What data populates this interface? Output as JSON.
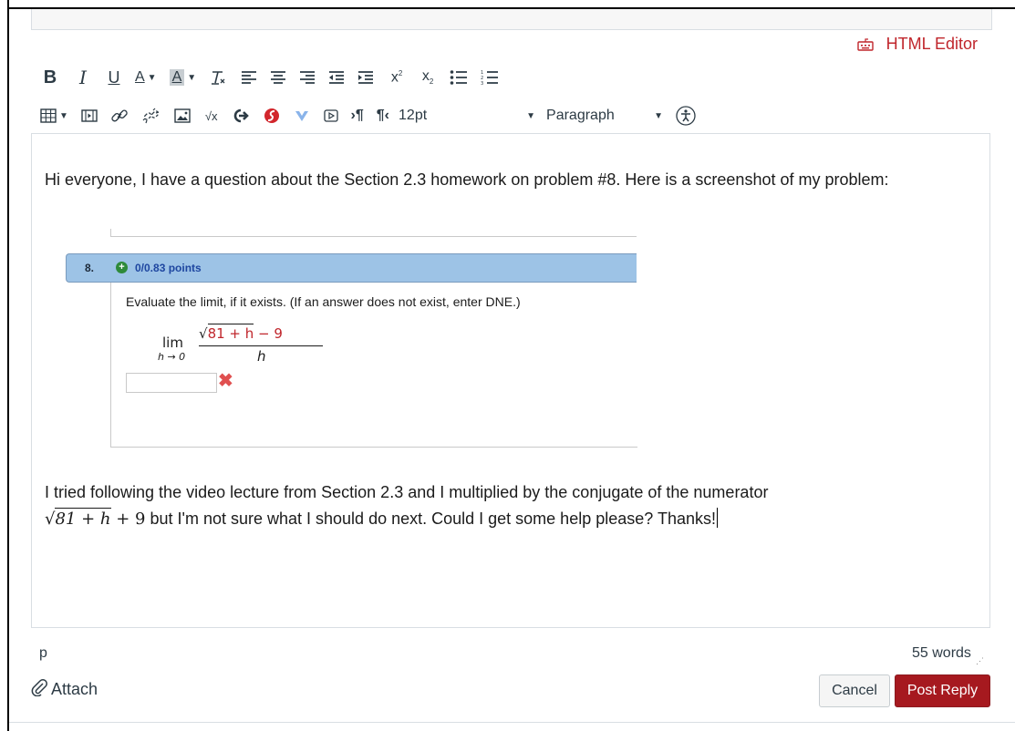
{
  "header": {
    "html_editor_label": "HTML Editor"
  },
  "toolbar": {
    "row1": [
      {
        "name": "bold-button",
        "icon": "bold-icon",
        "glyph": "B"
      },
      {
        "name": "italic-button",
        "icon": "italic-icon",
        "glyph": "I"
      },
      {
        "name": "underline-button",
        "icon": "underline-icon",
        "glyph": "U"
      },
      {
        "name": "text-color-button",
        "icon": "text-color-icon",
        "glyph": "A"
      },
      {
        "name": "background-color-button",
        "icon": "background-color-icon",
        "glyph": "A"
      },
      {
        "name": "clear-formatting-button",
        "icon": "clear-formatting-icon",
        "glyph": "Tx"
      },
      {
        "name": "align-left-button",
        "icon": "align-left-icon"
      },
      {
        "name": "align-center-button",
        "icon": "align-center-icon"
      },
      {
        "name": "align-right-button",
        "icon": "align-right-icon"
      },
      {
        "name": "outdent-button",
        "icon": "outdent-icon"
      },
      {
        "name": "indent-button",
        "icon": "indent-icon"
      },
      {
        "name": "superscript-button",
        "icon": "superscript-icon"
      },
      {
        "name": "subscript-button",
        "icon": "subscript-icon"
      },
      {
        "name": "bulleted-list-button",
        "icon": "bulleted-list-icon"
      },
      {
        "name": "numbered-list-button",
        "icon": "numbered-list-icon"
      }
    ],
    "font_size": "12pt",
    "block_format": "Paragraph"
  },
  "editor": {
    "paragraph1": "Hi everyone, I have a question about the Section 2.3 homework on problem #8. Here is a screenshot of my problem:",
    "paragraph2_before": "I tried following the video lecture from Section 2.3 and I multiplied by the conjugate of the numerator",
    "paragraph2_math": "81 + h",
    "paragraph2_math_tail": " + 9",
    "paragraph2_after": " but I'm not sure what I should do next. Could I get some help please? Thanks!"
  },
  "embedded_problem": {
    "number": "8.",
    "points": "0/0.83 points",
    "question": "Evaluate the limit, if it exists. (If an answer does not exist, enter DNE.)",
    "lim": "lim",
    "lim_sub": "h → 0",
    "numerator_radicand": "81 + h",
    "numerator_tail": " − 9",
    "denominator": "h",
    "answer_mark": "✖"
  },
  "status": {
    "element_path": "p",
    "word_count": "55 words"
  },
  "footer": {
    "attach_label": "Attach",
    "cancel_label": "Cancel",
    "post_reply_label": "Post Reply"
  }
}
